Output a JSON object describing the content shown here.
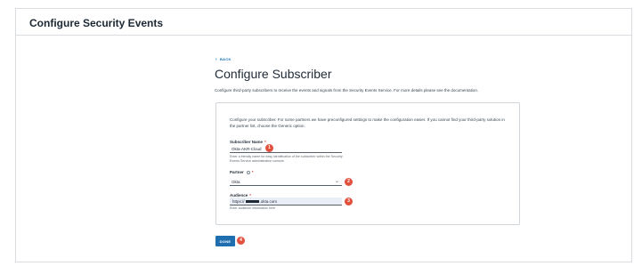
{
  "header": {
    "title": "Configure Security Events"
  },
  "back_label": "BACK",
  "page": {
    "title": "Configure Subscriber",
    "description": "Configure third-party subscribers to receive the events and signals from the Security Events Service. For more details please see the documentation."
  },
  "card": {
    "intro": "Configure your subscriber. For some partners we have preconfigured settings to make the configuration easier. If you cannot find your third-party solution in the partner list, choose the Generic option."
  },
  "fields": {
    "subscriber_name": {
      "label": "Subscriber Name",
      "required_mark": "*",
      "value": "Okta-AKR-Cloud",
      "helper": "Enter a friendly name for easy identification of the subscriber within the Security Events Service administration console."
    },
    "partner": {
      "label": "Partner",
      "required_mark": "*",
      "value": "Okta",
      "icon": "info-icon"
    },
    "audience": {
      "label": "Audience",
      "required_mark": "*",
      "value_prefix": "https://",
      "value_suffix": ".okta.com",
      "helper": "Enter audience information here"
    }
  },
  "done_label": "DONE",
  "badges": [
    "1",
    "2",
    "3",
    "4"
  ],
  "colors": {
    "accent": "#1f6fb0",
    "badge": "#e2513e",
    "required": "#d53a35"
  }
}
